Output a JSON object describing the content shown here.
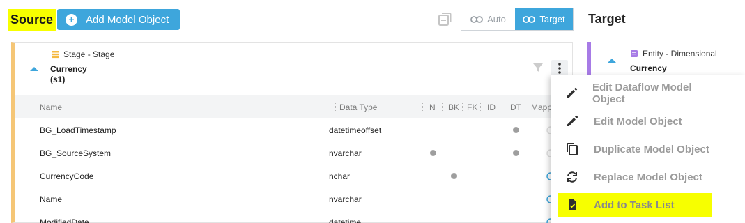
{
  "header": {
    "source_title": "Source",
    "add_button_label": "Add Model Object",
    "toggle_auto_label": "Auto",
    "toggle_target_label": "Target",
    "target_title": "Target"
  },
  "source_card": {
    "stage_label": "Stage - Stage",
    "entity_name": "Currency",
    "entity_sub": "(s1)"
  },
  "table": {
    "columns": [
      "Name",
      "Data Type",
      "N",
      "BK",
      "FK",
      "ID",
      "DT",
      "Mapp"
    ],
    "rows": [
      {
        "name": "BG_LoadTimestamp",
        "type": "datetimeoffset",
        "flags": [
          "DT"
        ],
        "mapped": false
      },
      {
        "name": "BG_SourceSystem",
        "type": "nvarchar",
        "flags": [
          "N",
          "DT"
        ],
        "mapped": false
      },
      {
        "name": "CurrencyCode",
        "type": "nchar",
        "flags": [
          "BK"
        ],
        "mapped": true
      },
      {
        "name": "Name",
        "type": "nvarchar",
        "flags": [],
        "mapped": true
      },
      {
        "name": "ModifiedDate",
        "type": "datetime",
        "flags": [],
        "mapped": true
      }
    ]
  },
  "target_card": {
    "entity_label": "Entity - Dimensional",
    "entity_name": "Currency"
  },
  "menu": {
    "items": [
      {
        "label": "Edit Dataflow Model Object",
        "icon": "pencil-icon"
      },
      {
        "label": "Edit Model Object",
        "icon": "pencil-icon"
      },
      {
        "label": "Duplicate Model Object",
        "icon": "copy-icon"
      },
      {
        "label": "Replace Model Object",
        "icon": "replace-icon"
      },
      {
        "label": "Add to Task List",
        "icon": "task-check-icon"
      }
    ]
  },
  "colors": {
    "accent": "#3ea6dc",
    "highlight": "#f7ff00",
    "source_bar": "#f5c676",
    "target_bar": "#a77be6"
  }
}
